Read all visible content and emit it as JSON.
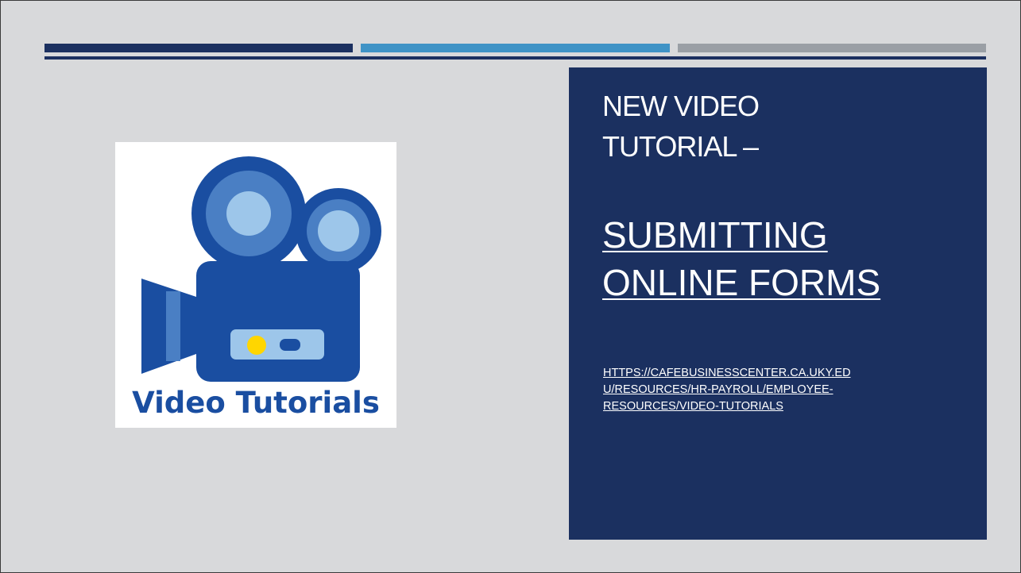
{
  "slide": {
    "heading_line_1": "NEW VIDEO",
    "heading_line_2": "TUTORIAL –",
    "title_line_1": "SUBMITTING",
    "title_line_2": "ONLINE FORMS",
    "url_line_1": "HTTPS://CAFEBUSINESSCENTER.CA.UKY.ED",
    "url_line_2": "U/RESOURCES/HR-PAYROLL/EMPLOYEE-",
    "url_line_3": "RESOURCES/VIDEO-TUTORIALS"
  },
  "graphic": {
    "caption": "Video Tutorials",
    "icon": "video-camera-icon"
  },
  "colors": {
    "background": "#d8d9db",
    "panel": "#1b3060",
    "band_dark": "#1b3060",
    "band_blue": "#3f93c6",
    "band_gray": "#9a9fa5",
    "camera_dark": "#1a4ea1",
    "camera_mid": "#4a7fc4",
    "camera_light": "#9dc6ea",
    "record_light": "#ffd600"
  }
}
